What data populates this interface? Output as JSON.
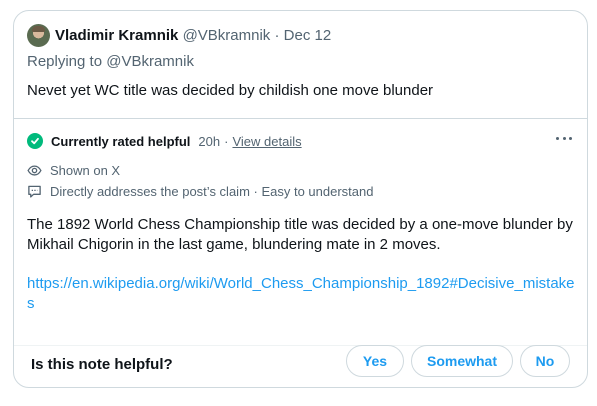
{
  "tweet": {
    "author_name": "Vladimir Kramnik",
    "handle": "@VBkramnik",
    "separator": "·",
    "date": "Dec 12",
    "replying_prefix": "Replying to",
    "replying_to": "@VBkramnik",
    "text": "Nevet yet WC title was decided by childish one move blunder"
  },
  "note": {
    "status_icon": "check-circle-icon",
    "status": "Currently rated helpful",
    "time": "20h",
    "separator": "·",
    "view_details": "View details",
    "more_icon": "more-horizontal-icon",
    "shown_icon": "eye-icon",
    "shown": "Shown on X",
    "addresses_icon": "chat-bubble-icon",
    "addresses": "Directly addresses the post’s claim · Easy to understand",
    "text": "The 1892 World Chess Championship title was decided by a one-move blunder by Mikhail Chigorin in the last game, blundering mate in 2 moves.",
    "link": "https://en.wikipedia.org/wiki/World_Chess_Championship_1892#Decisive_mistakes"
  },
  "feedback": {
    "question": "Is this note helpful?",
    "yes": "Yes",
    "somewhat": "Somewhat",
    "no": "No"
  },
  "colors": {
    "accent": "#1d9bf0",
    "helpful_green": "#00ba7c",
    "secondary_text": "#536471",
    "border": "#cfd9de"
  }
}
